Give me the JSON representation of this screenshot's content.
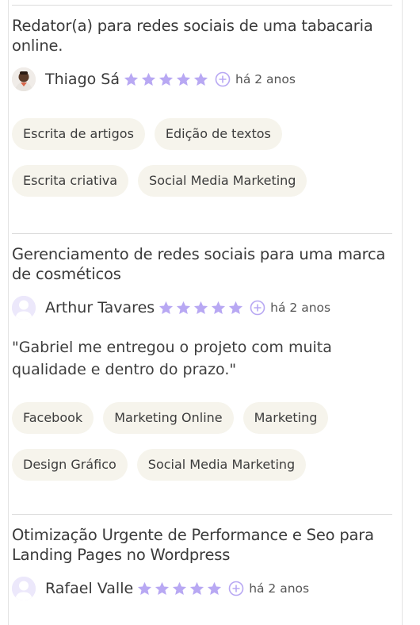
{
  "colors": {
    "star": "#b8a8f3",
    "avatar_bg": "#ece8fb",
    "tag_bg": "#f6f4ec"
  },
  "reviews": [
    {
      "title": "Redator(a) para redes sociais de uma tabacaria online.",
      "author": "Thiago Sá",
      "rating": 5,
      "time_ago": "há 2 anos",
      "quote": "",
      "tags": [
        "Escrita de artigos",
        "Edição de textos",
        "Escrita criativa",
        "Social Media Marketing"
      ]
    },
    {
      "title": "Gerenciamento de redes sociais para uma marca de cosméticos",
      "author": "Arthur Tavares",
      "rating": 5,
      "time_ago": "há 2 anos",
      "quote": "\"Gabriel me entregou o projeto com muita qualidade e dentro do prazo.\"",
      "tags": [
        "Facebook",
        "Marketing Online",
        "Marketing",
        "Design Gráfico",
        "Social Media Marketing"
      ]
    },
    {
      "title": "Otimização Urgente de Performance e Seo para Landing Pages no Wordpress",
      "author": "Rafael Valle",
      "rating": 5,
      "time_ago": "há 2 anos",
      "quote": "",
      "tags": []
    }
  ]
}
